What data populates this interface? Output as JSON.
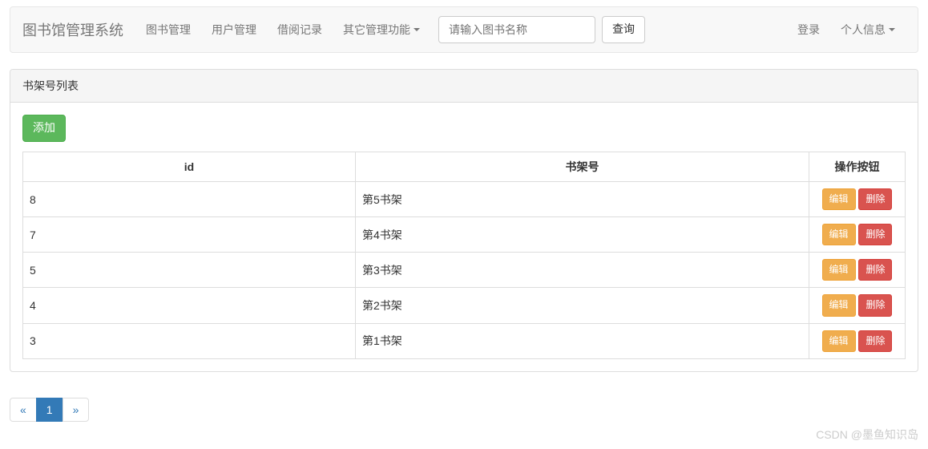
{
  "navbar": {
    "brand": "图书馆管理系统",
    "items": [
      {
        "label": "图书管理",
        "dropdown": false
      },
      {
        "label": "用户管理",
        "dropdown": false
      },
      {
        "label": "借阅记录",
        "dropdown": false
      },
      {
        "label": "其它管理功能",
        "dropdown": true
      }
    ],
    "search": {
      "placeholder": "请输入图书名称",
      "button": "查询"
    },
    "right": [
      {
        "label": "登录",
        "dropdown": false
      },
      {
        "label": "个人信息",
        "dropdown": true
      }
    ]
  },
  "panel": {
    "heading": "书架号列表",
    "add_button": "添加",
    "columns": {
      "id": "id",
      "shelf": "书架号",
      "actions": "操作按钮"
    },
    "rows": [
      {
        "id": "8",
        "shelf": "第5书架"
      },
      {
        "id": "7",
        "shelf": "第4书架"
      },
      {
        "id": "5",
        "shelf": "第3书架"
      },
      {
        "id": "4",
        "shelf": "第2书架"
      },
      {
        "id": "3",
        "shelf": "第1书架"
      }
    ],
    "action_labels": {
      "edit": "编辑",
      "delete": "删除"
    }
  },
  "pagination": {
    "prev": "«",
    "next": "»",
    "pages": [
      "1"
    ],
    "active": "1"
  },
  "watermark": "CSDN @墨鱼知识岛"
}
